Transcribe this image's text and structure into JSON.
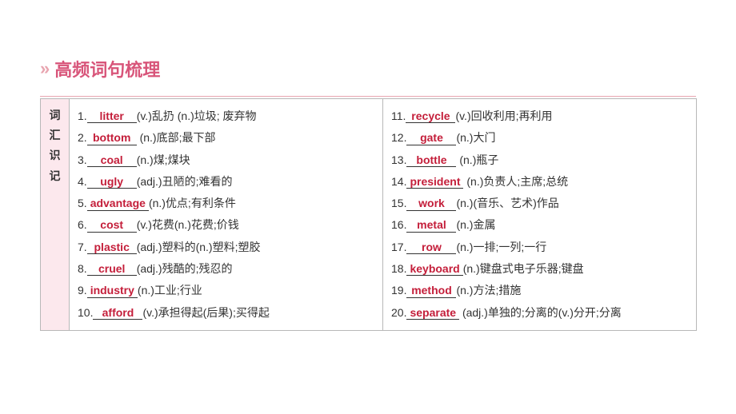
{
  "header": {
    "chevrons": "»",
    "title": "高频词句梳理"
  },
  "sideLabel": "词汇识记",
  "left": [
    {
      "num": "1.",
      "answer": "litter",
      "def": "(v.)乱扔 (n.)垃圾; 废弃物"
    },
    {
      "num": "2.",
      "answer": "bottom",
      "def": " (n.)底部;最下部"
    },
    {
      "num": "3.",
      "answer": "coal",
      "def": "(n.)煤;煤块"
    },
    {
      "num": "4.",
      "answer": "ugly",
      "def": "(adj.)丑陋的;难看的"
    },
    {
      "num": "5.",
      "answer": "advantage",
      "def": "(n.)优点;有利条件"
    },
    {
      "num": "6.",
      "answer": "cost",
      "def": "(v.)花费(n.)花费;价钱"
    },
    {
      "num": "7.",
      "answer": "plastic",
      "def": "(adj.)塑料的(n.)塑料;塑胶"
    },
    {
      "num": "8.",
      "answer": "cruel",
      "def": "(adj.)残酷的;残忍的"
    },
    {
      "num": "9.",
      "answer": "industry",
      "def": "(n.)工业;行业"
    },
    {
      "num": "10.",
      "answer": "afford",
      "def": "(v.)承担得起(后果);买得起"
    }
  ],
  "right": [
    {
      "num": "11.",
      "answer": "recycle",
      "def": "(v.)回收利用;再利用"
    },
    {
      "num": "12.",
      "answer": "gate",
      "def": "(n.)大门"
    },
    {
      "num": "13.",
      "answer": "bottle",
      "def": " (n.)瓶子"
    },
    {
      "num": "14.",
      "answer": "president",
      "def": " (n.)负责人;主席;总统"
    },
    {
      "num": "15.",
      "answer": "work",
      "def": "(n.)(音乐、艺术)作品"
    },
    {
      "num": "16.",
      "answer": "metal",
      "def": "(n.)金属"
    },
    {
      "num": "17.",
      "answer": "row",
      "def": "(n.)一排;一列;一行"
    },
    {
      "num": "18.",
      "answer": "keyboard",
      "def": "(n.)键盘式电子乐器;键盘"
    },
    {
      "num": "19.",
      "answer": "method",
      "def": "(n.)方法;措施"
    },
    {
      "num": "20.",
      "answer": "separate",
      "def": " (adj.)单独的;分离的(v.)分开;分离"
    }
  ]
}
